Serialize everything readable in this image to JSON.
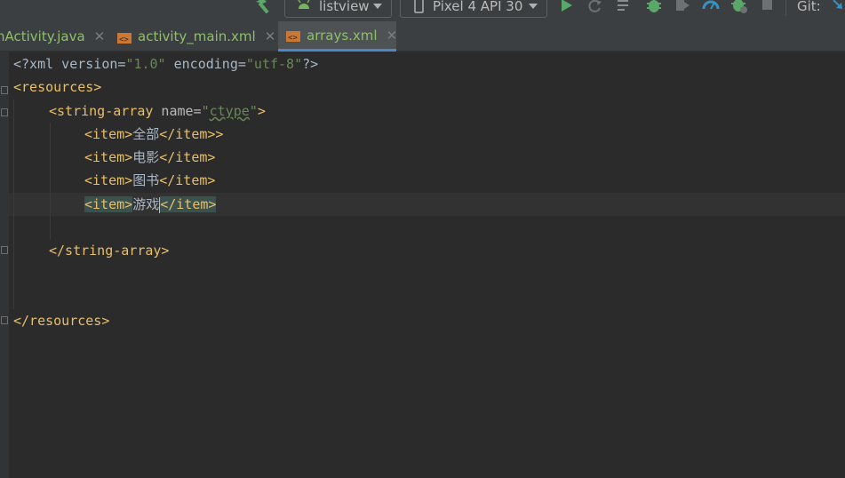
{
  "toolbar": {
    "run_config": "listview",
    "device": "Pixel 4 API 30",
    "git_label": "Git:",
    "icons": [
      "hammer-icon",
      "android-icon",
      "phone-icon",
      "run-icon",
      "rerun-icon",
      "logcat-icon",
      "debug-icon",
      "attach-debugger-icon",
      "profiler-icon",
      "apply-changes-icon",
      "stop-icon"
    ]
  },
  "tabs": [
    {
      "label": "nActivity.java",
      "close": "✕"
    },
    {
      "label": "activity_main.xml",
      "close": "✕"
    },
    {
      "label": "arrays.xml",
      "close": "✕",
      "active": true
    }
  ],
  "code": {
    "l1_decl_open": "<?xml version=",
    "l1_version": "\"1.0\"",
    "l1_enc": " encoding=",
    "l1_enc_val": "\"utf-8\"",
    "l1_close": "?>",
    "l2": "<resources>",
    "l3_tag": "<string-array",
    "l3_attr": " name=",
    "l3_val_q1": "\"",
    "l3_val": "ctype",
    "l3_val_q2": "\"",
    "l3_close": ">",
    "item_open": "<item>",
    "item_close": "</item>",
    "item1_text": "全部",
    "item1_extra": ">",
    "item2_text": "电影",
    "item3_text": "图书",
    "item4_text_a": "游戏",
    "l9": "</string-array>",
    "l12": "</resources>"
  },
  "colors": {
    "tag": "#e8bf6a",
    "string": "#6a8759",
    "text": "#a9b7c6",
    "accent_tab": "#4a88c7",
    "run_green": "#59a869"
  }
}
